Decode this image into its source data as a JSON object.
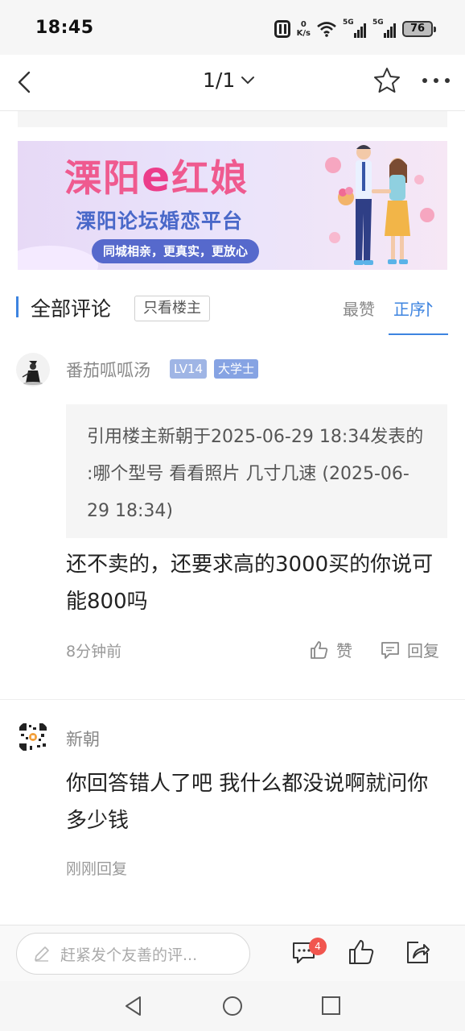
{
  "status_bar": {
    "time": "18:45",
    "net_speed_top": "0",
    "net_speed_bottom": "K/s",
    "sim1_label": "5G",
    "sim2_label": "5G",
    "battery": "76",
    "icons": [
      "nfc-icon",
      "wifi-icon",
      "signal-icon",
      "battery-icon"
    ]
  },
  "nav": {
    "page_indicator": "1/1",
    "icons": [
      "back-arrow-icon",
      "chevron-down-icon",
      "star-icon",
      "more-icon"
    ]
  },
  "banner": {
    "title_part1": "溧阳",
    "title_e": "e",
    "title_part2": "红娘",
    "subtitle": "溧阳论坛婚恋平台",
    "pill": "同城相亲，更真实，更放心"
  },
  "comments_section": {
    "title": "全部评论",
    "op_only_button": "只看楼主",
    "sort_hot": "最赞",
    "sort_asc": "正序"
  },
  "comments": [
    {
      "user": "番茄呱呱汤",
      "level": "LV14",
      "rank": "大学士",
      "quote": "引用楼主新朝于2025-06-29 18:34发表的 :哪个型号 看看照片 几寸几速 (2025-06-29 18:34)",
      "body": "还不卖的，还要求高的3000买的你说可能800吗",
      "time": "8分钟前",
      "like_label": "赞",
      "reply_label": "回复"
    },
    {
      "user": "新朝",
      "body": "你回答错人了吧 我什么都没说啊就问你多少钱",
      "time": "刚刚回复"
    }
  ],
  "bottom_bar": {
    "input_placeholder": "赶紧发个友善的评...",
    "comment_count": "4",
    "icons": [
      "pencil-icon",
      "comment-icon",
      "thumb-up-icon",
      "share-icon"
    ]
  },
  "system_nav": {
    "icons": [
      "back-triangle-icon",
      "home-circle-icon",
      "recents-square-icon"
    ]
  },
  "colors": {
    "accent": "#3d84e0",
    "badge_red": "#f1564f",
    "banner_pink": "#ef5a8f",
    "banner_blue": "#4968c9"
  }
}
